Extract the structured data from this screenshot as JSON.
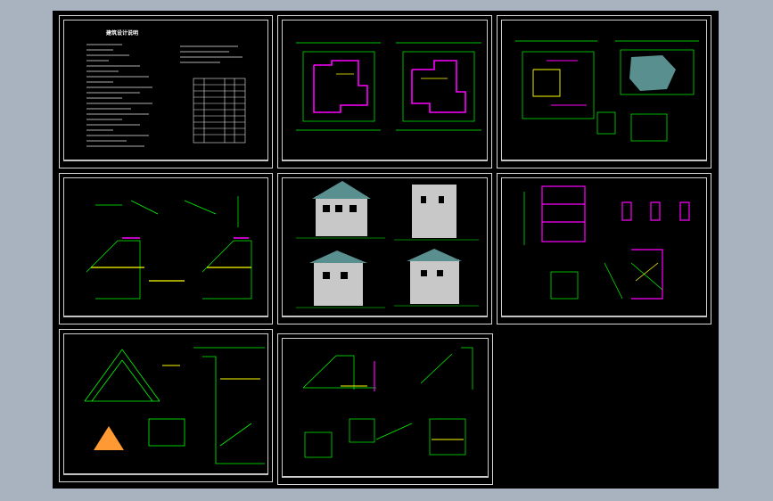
{
  "drawing": {
    "design_notes_title": "建筑设计说明"
  },
  "colors": {
    "background": "#000000",
    "frame": "#d8d8d8",
    "line_green": "#00ff00",
    "line_magenta": "#ff00ff",
    "line_yellow": "#ffff00",
    "line_cyan": "#00ffff",
    "fill_grey": "#c8c8c8",
    "fill_teal": "#5a8f8f"
  }
}
